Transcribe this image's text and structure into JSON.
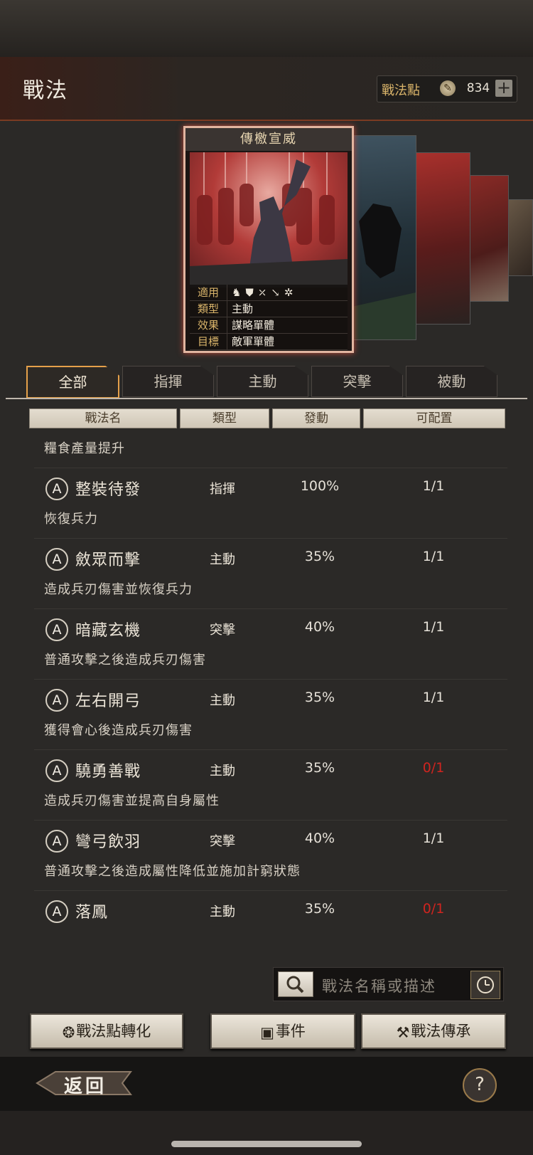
{
  "header": {
    "title": "戰法",
    "points_label": "戰法點",
    "points_value": "834",
    "plus": "+"
  },
  "card": {
    "title": "傳檄宣威",
    "rows": [
      {
        "key": "適用",
        "value": ""
      },
      {
        "key": "類型",
        "value": "主動"
      },
      {
        "key": "效果",
        "value": "謀略單體"
      },
      {
        "key": "目標",
        "value": "敵軍單體"
      }
    ]
  },
  "tabs": [
    "全部",
    "指揮",
    "主動",
    "突擊",
    "被動"
  ],
  "columns": [
    "戰法名",
    "類型",
    "發動",
    "可配置"
  ],
  "list": {
    "partial_desc": "糧食產量提升",
    "rows": [
      {
        "badge": "A",
        "name": "整裝待發",
        "type": "指揮",
        "rate": "100%",
        "slot": "1/1",
        "desc": "恢復兵力"
      },
      {
        "badge": "A",
        "name": "斂眾而擊",
        "type": "主動",
        "rate": "35%",
        "slot": "1/1",
        "desc": "造成兵刃傷害並恢復兵力"
      },
      {
        "badge": "A",
        "name": "暗藏玄機",
        "type": "突擊",
        "rate": "40%",
        "slot": "1/1",
        "desc": "普通攻擊之後造成兵刃傷害"
      },
      {
        "badge": "A",
        "name": "左右開弓",
        "type": "主動",
        "rate": "35%",
        "slot": "1/1",
        "desc": "獲得會心後造成兵刃傷害"
      },
      {
        "badge": "A",
        "name": "驍勇善戰",
        "type": "主動",
        "rate": "35%",
        "slot": "0/1",
        "desc": "造成兵刃傷害並提高自身屬性"
      },
      {
        "badge": "A",
        "name": "彎弓飲羽",
        "type": "突擊",
        "rate": "40%",
        "slot": "1/1",
        "desc": "普通攻擊之後造成屬性降低並施加計窮狀態"
      },
      {
        "badge": "A",
        "name": "落鳳",
        "type": "主動",
        "rate": "35%",
        "slot": "0/1",
        "desc": ""
      }
    ]
  },
  "search": {
    "placeholder": "戰法名稱或描述"
  },
  "actions": {
    "convert": "戰法點轉化",
    "event": "事件",
    "inherit": "戰法傳承"
  },
  "footer": {
    "back": "返回",
    "help": "?"
  },
  "colors": {
    "accent": "#e5a04a",
    "unavailable": "#d0241f"
  }
}
